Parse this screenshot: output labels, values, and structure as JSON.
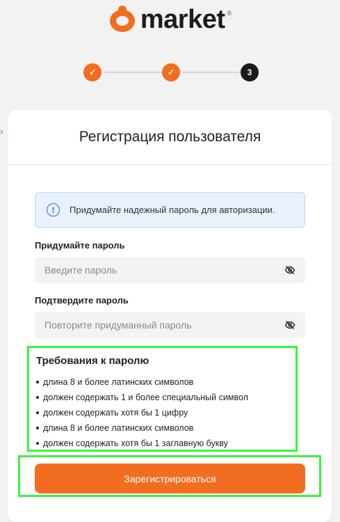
{
  "brand": {
    "name": "market",
    "registered": "®",
    "accent_color": "#f26d1f"
  },
  "stepper": {
    "steps": [
      {
        "state": "done",
        "label": "✓"
      },
      {
        "state": "done",
        "label": "✓"
      },
      {
        "state": "current",
        "label": "3"
      }
    ]
  },
  "side": {
    "arrow": "›"
  },
  "form": {
    "title": "Регистрация пользователя",
    "info": {
      "icon": "!",
      "text": "Придумайте надежный пароль для авторизации."
    },
    "password": {
      "label": "Придумайте пароль",
      "placeholder": "Введите пароль",
      "value": ""
    },
    "confirm": {
      "label": "Подтвердите пароль",
      "placeholder": "Повторите придуманный пароль",
      "value": ""
    },
    "requirements": {
      "title": "Требования к паролю",
      "items": [
        "длина 8 и более латинских символов",
        "должен содержать 1 и более специальный символ",
        "должен содержать хотя бы 1 цифру",
        "длина 8 и более латинских символов",
        "должен содержать хотя бы 1 заглавную букву"
      ]
    },
    "submit_label": "Зарегистрироваться",
    "highlight_color": "#3ef23e"
  }
}
